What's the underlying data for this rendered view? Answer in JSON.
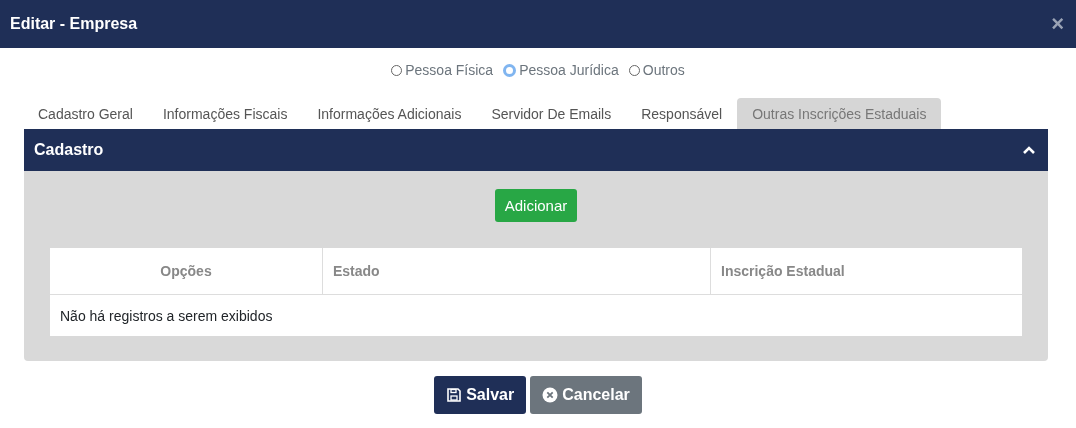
{
  "window": {
    "title": "Editar - Empresa",
    "close": "×"
  },
  "person_types": [
    {
      "label": "Pessoa Física",
      "selected": false
    },
    {
      "label": "Pessoa Jurídica",
      "selected": true
    },
    {
      "label": "Outros",
      "selected": false
    }
  ],
  "tabs": [
    {
      "label": "Cadastro Geral",
      "selected": false
    },
    {
      "label": "Informações Fiscais",
      "selected": false
    },
    {
      "label": "Informações Adicionais",
      "selected": false
    },
    {
      "label": "Servidor De Emails",
      "selected": false
    },
    {
      "label": "Responsável",
      "selected": false
    },
    {
      "label": "Outras Inscrições Estaduais",
      "selected": true
    }
  ],
  "panel": {
    "title": "Cadastro",
    "expanded": true,
    "add_button": "Adicionar",
    "table": {
      "columns": [
        "Opções",
        "Estado",
        "Inscrição Estadual"
      ],
      "empty_message": "Não há registros a serem exibidos"
    }
  },
  "buttons": [
    {
      "kind": "save",
      "label": "Salvar"
    },
    {
      "kind": "cancel",
      "label": "Cancelar"
    }
  ]
}
